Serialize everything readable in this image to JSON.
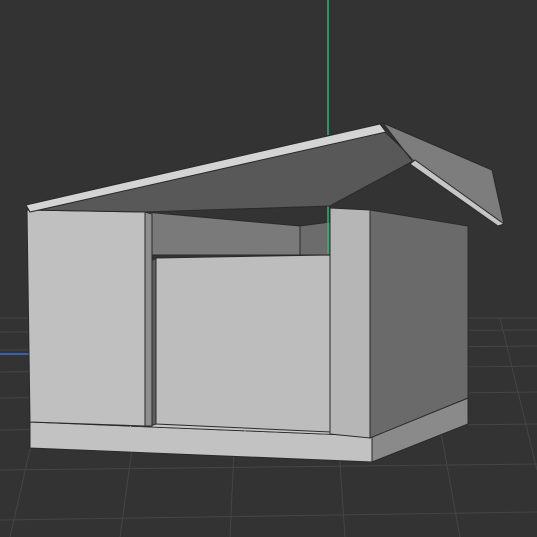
{
  "viewport": {
    "background": "#333333",
    "grid_color": "#3f3f3f",
    "y_axis_color": "#2bb673",
    "x_axis_color": "#3a73d6"
  },
  "model": {
    "wall_light": "#bdbdbd",
    "wall_mid": "#a9a9a9",
    "wall_dark": "#6f6f6f",
    "roof_top": "#bcbcbc",
    "roof_under": "#5a5a5a",
    "edge": "#2a2a2a"
  }
}
